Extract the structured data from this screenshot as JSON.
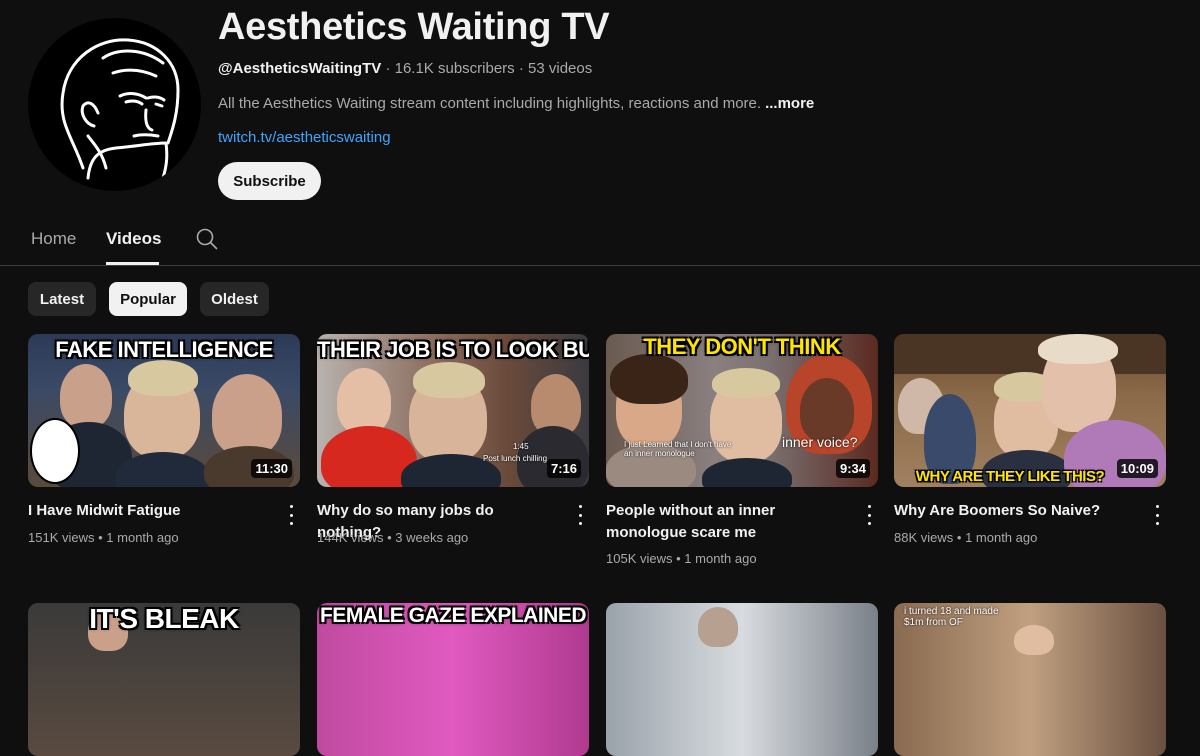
{
  "channel": {
    "name": "Aesthetics Waiting TV",
    "handle": "@AestheticsWaitingTV",
    "subscribers": "16.1K subscribers",
    "videos_count": "53 videos",
    "separator": "·",
    "description": "All the Aesthetics Waiting stream content including highlights, reactions and more.",
    "more_label": "...more",
    "link": "twitch.tv/aestheticswaiting",
    "subscribe_label": "Subscribe"
  },
  "tabs": [
    {
      "label": "Home",
      "active": false
    },
    {
      "label": "Videos",
      "active": true
    }
  ],
  "search_icon": "search-icon",
  "filters": [
    {
      "label": "Latest",
      "selected": false
    },
    {
      "label": "Popular",
      "selected": true
    },
    {
      "label": "Oldest",
      "selected": false
    }
  ],
  "videos": [
    {
      "title": "I Have Midwit Fatigue",
      "views": "151K views",
      "age": "1 month ago",
      "duration": "11:30",
      "thumb_text": "FAKE INTELLIGENCE"
    },
    {
      "title": "Why do so many jobs do nothing?",
      "views": "144K views",
      "age": "3 weeks ago",
      "duration": "7:16",
      "thumb_text": "THEIR JOB IS TO LOOK BUSY",
      "thumb_small": "1:45",
      "thumb_small2": "Post lunch chilling"
    },
    {
      "title": "People without an inner monologue scare me",
      "views": "105K views",
      "age": "1 month ago",
      "duration": "9:34",
      "thumb_text": "THEY DON'T THINK",
      "thumb_small": "I just Learned that I don't have an inner monologue",
      "thumb_small2": "inner voice?"
    },
    {
      "title": "Why Are Boomers So Naive?",
      "views": "88K views",
      "age": "1 month ago",
      "duration": "10:09",
      "thumb_text": "WHY ARE THEY LIKE THIS?"
    }
  ],
  "videos_row2": [
    {
      "thumb_text": "IT'S BLEAK"
    },
    {
      "thumb_text": "FEMALE GAZE EXPLAINED"
    },
    {
      "thumb_text": ""
    },
    {
      "thumb_text": "i turned 18 and made $1m from OF"
    }
  ],
  "meta_separator": "•",
  "colors": {
    "background": "#0f0f0f",
    "link": "#3ea6ff",
    "muted": "#aaaaaa",
    "chip": "#272727"
  }
}
